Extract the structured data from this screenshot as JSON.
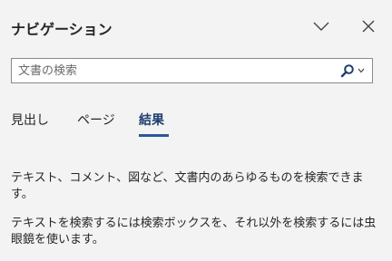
{
  "pane": {
    "title": "ナビゲーション",
    "options_icon": "chevron-down-icon",
    "close_icon": "close-icon"
  },
  "search": {
    "placeholder": "文書の検索",
    "value": "",
    "button_icon": "search-icon",
    "dropdown_icon": "chevron-down-icon"
  },
  "tabs": [
    {
      "label": "見出し",
      "selected": false
    },
    {
      "label": "ページ",
      "selected": false
    },
    {
      "label": "結果",
      "selected": true
    }
  ],
  "results": {
    "line1": "テキスト、コメント、図など、文書内のあらゆるものを検索できます。",
    "line2": "テキストを検索するには検索ボックスを、それ以外を検索するには虫眼鏡を使います。"
  },
  "colors": {
    "background": "#f3f3f3",
    "accent": "#2b579a",
    "selected_tab_text": "#1e3e70",
    "search_icon": "#1e3e70"
  }
}
